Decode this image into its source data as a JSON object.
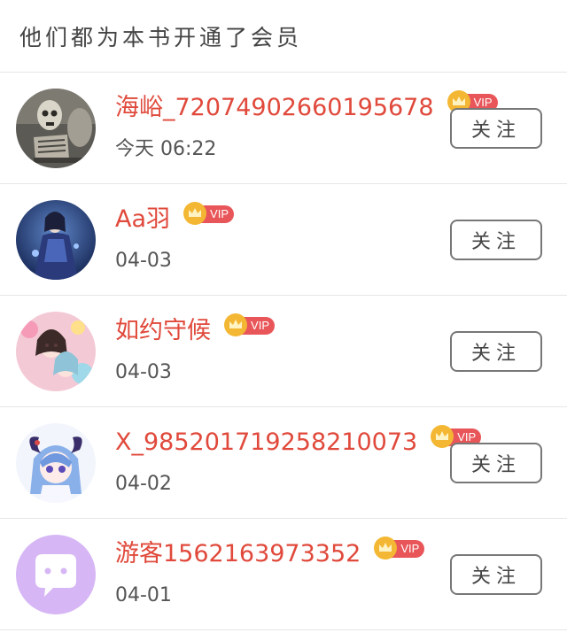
{
  "header": {
    "title": "他们都为本书开通了会员"
  },
  "vip_label": "VIP",
  "follow_label": "关注",
  "members": [
    {
      "name": "海峪_72074902660195678",
      "date": "今天  06:22",
      "avatar": "skeleton-avatar"
    },
    {
      "name": "Aa羽",
      "date": "04-03",
      "avatar": "anime-blue-avatar"
    },
    {
      "name": "如约守候",
      "date": "04-03",
      "avatar": "anime-pink-avatar"
    },
    {
      "name": "X_985201719258210073",
      "date": "04-02",
      "avatar": "anime-horned-avatar"
    },
    {
      "name": "游客1562163973352",
      "date": "04-01",
      "avatar": "default-chat-avatar"
    }
  ],
  "colors": {
    "name": "#e0493b",
    "vip_badge": "#e8565a",
    "crown": "#f3b733",
    "default_avatar": "#d6b6f5"
  }
}
